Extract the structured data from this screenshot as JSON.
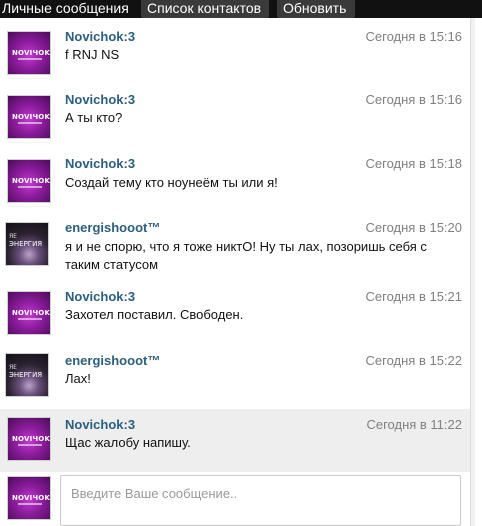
{
  "header": {
    "title": "Личные сообщения",
    "contacts_button": "Список контактов",
    "refresh_button": "Обновить"
  },
  "avatars": {
    "novichok_logo": "NOVIЧOK",
    "energ_line1": "ЯЕ",
    "energ_line2": "ЭНЕРГИЯ"
  },
  "messages": [
    {
      "author": "Novichok:3",
      "time": "Сегодня в 15:16",
      "text": "f RNJ NS",
      "avatar": "novichok"
    },
    {
      "author": "Novichok:3",
      "time": "Сегодня в 15:16",
      "text": "А ты кто?",
      "avatar": "novichok"
    },
    {
      "author": "Novichok:3",
      "time": "Сегодня в 15:18",
      "text": "Создай тему кто ноунеём ты или я!",
      "avatar": "novichok"
    },
    {
      "author": "energishooot™",
      "time": "Сегодня в 15:20",
      "text": "я и не спорю, что я тоже никтО! Ну ты лах, позоришь себя с таким статусом",
      "avatar": "energ"
    },
    {
      "author": "Novichok:3",
      "time": "Сегодня в 15:21",
      "text": "Захотел поставил. Свободен.",
      "avatar": "novichok"
    },
    {
      "author": "energishooot™",
      "time": "Сегодня в 15:22",
      "text": "Лах!",
      "avatar": "energ"
    },
    {
      "author": "Novichok:3",
      "time": "Сегодня в 11:22",
      "text": "Щас жалобу напишу.",
      "avatar": "novichok",
      "highlight": true
    }
  ],
  "composer": {
    "placeholder": "Введите Ваше сообщение.."
  },
  "colors": {
    "topbar": "#111111",
    "author": "#2b5f7e",
    "time": "#808080",
    "highlight_row": "#eeeeee"
  }
}
